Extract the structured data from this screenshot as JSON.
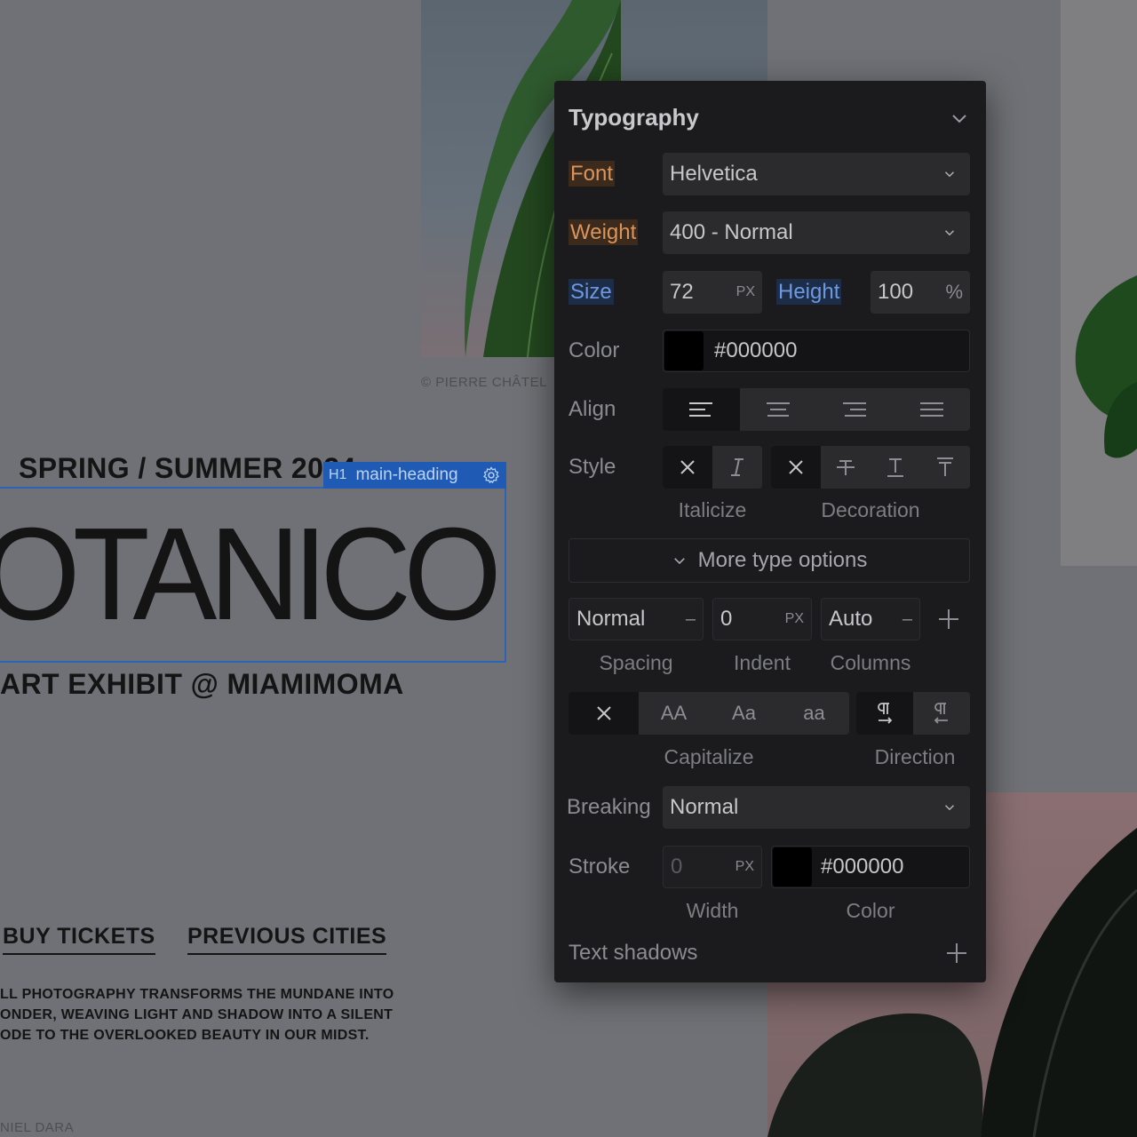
{
  "page": {
    "credit_top": "© PIERRE CHÂTEL",
    "subtitle_top": "SPRING / SUMMER 2024",
    "heading": "OTANICO",
    "subtitle_bottom": "ART EXHIBIT @ MIAMIMOMA",
    "links": [
      "BUY TICKETS",
      "PREVIOUS CITIES"
    ],
    "body_copy": [
      "LL PHOTOGRAPHY TRANSFORMS THE MUNDANE INTO",
      "ONDER, WEAVING LIGHT AND SHADOW INTO A SILENT",
      "ODE TO THE OVERLOOKED BEAUTY IN OUR MIDST."
    ],
    "credit_bottom": "NIEL DARA"
  },
  "selection": {
    "tag": "H1",
    "name": "main-heading"
  },
  "panel": {
    "title": "Typography",
    "font": {
      "label": "Font",
      "value": "Helvetica"
    },
    "weight": {
      "label": "Weight",
      "value": "400 - Normal"
    },
    "size": {
      "label": "Size",
      "value": "72",
      "unit": "PX"
    },
    "height": {
      "label": "Height",
      "value": "100",
      "unit": "%"
    },
    "color": {
      "label": "Color",
      "value": "#000000",
      "swatch": "#000000"
    },
    "align": {
      "label": "Align",
      "options": [
        "left",
        "center",
        "right",
        "justify"
      ],
      "selected": "left"
    },
    "style": {
      "label": "Style",
      "italicize_caption": "Italicize",
      "decoration_caption": "Decoration"
    },
    "more_options": "More type options",
    "spacing": {
      "value": "Normal",
      "caption": "Spacing"
    },
    "indent": {
      "value": "0",
      "unit": "PX",
      "caption": "Indent"
    },
    "columns": {
      "value": "Auto",
      "caption": "Columns"
    },
    "capitalize": {
      "caption": "Capitalize",
      "options": [
        "AA",
        "Aa",
        "aa"
      ]
    },
    "direction": {
      "caption": "Direction"
    },
    "breaking": {
      "label": "Breaking",
      "value": "Normal"
    },
    "stroke": {
      "label": "Stroke",
      "width": "0",
      "unit": "PX",
      "color": "#000000",
      "width_caption": "Width",
      "color_caption": "Color"
    },
    "text_shadows": "Text shadows"
  },
  "colors": {
    "accent": "#1f5bb5",
    "panel_bg": "#1b1b1d",
    "label_orange": "#d9955c",
    "label_blue": "#6c99e0"
  }
}
